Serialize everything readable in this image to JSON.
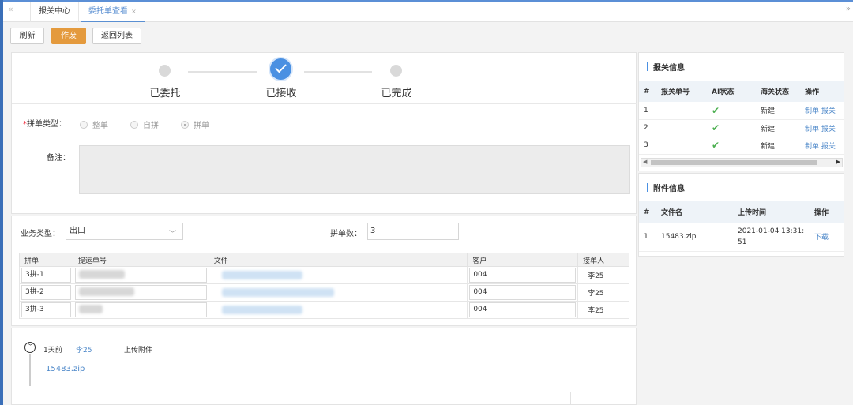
{
  "tabs": [
    {
      "label": "报关中心"
    },
    {
      "label": "委托单查看",
      "close": "×"
    }
  ],
  "toolbar": {
    "refresh": "刷新",
    "void": "作废",
    "back": "返回列表"
  },
  "steps": [
    "已委托",
    "已接收",
    "已完成"
  ],
  "form": {
    "split_type_label": "拼单类型：",
    "split_options": [
      "整单",
      "自拼",
      "拼单"
    ],
    "remark_label": "备注：",
    "business_type_label": "业务类型：",
    "business_type_value": "出口",
    "split_count_label": "拼单数：",
    "split_count_value": "3"
  },
  "sub_table": {
    "headers": [
      "拼单",
      "提运单号",
      "文件",
      "客户",
      "接单人"
    ],
    "rows": [
      {
        "split": "3拼-1",
        "customer": "004",
        "receiver": "李25"
      },
      {
        "split": "3拼-2",
        "customer": "004",
        "receiver": "李25"
      },
      {
        "split": "3拼-3",
        "customer": "004",
        "receiver": "李25"
      }
    ]
  },
  "timeline": {
    "time": "1天前",
    "user": "李25",
    "action": "上传附件",
    "file": "15483.zip"
  },
  "customs": {
    "title": "报关信息",
    "headers": [
      "#",
      "报关单号",
      "AI状态",
      "海关状态",
      "操作"
    ],
    "rows": [
      {
        "idx": "1",
        "status": "新建",
        "op1": "制单",
        "op2": "报关"
      },
      {
        "idx": "2",
        "status": "新建",
        "op1": "制单",
        "op2": "报关"
      },
      {
        "idx": "3",
        "status": "新建",
        "op1": "制单",
        "op2": "报关"
      }
    ]
  },
  "attach": {
    "title": "附件信息",
    "headers": [
      "#",
      "文件名",
      "上传时间",
      "操作"
    ],
    "rows": [
      {
        "idx": "1",
        "name": "15483.zip",
        "time": "2021-01-04 13:31:51",
        "op": "下载"
      }
    ]
  },
  "colors": {
    "accent": "#4a90e2",
    "warning": "#e49a3d",
    "success": "#4caf50"
  }
}
